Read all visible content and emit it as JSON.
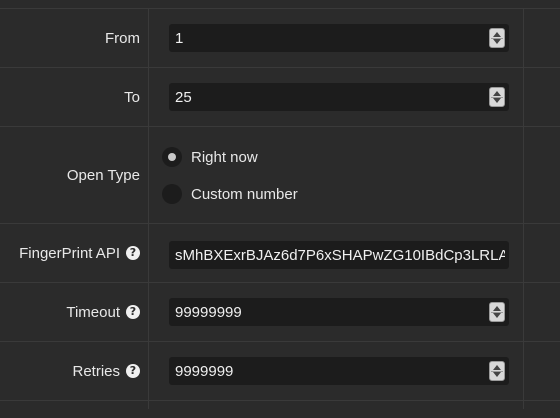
{
  "fields": {
    "from": {
      "label": "From",
      "value": "1"
    },
    "to": {
      "label": "To",
      "value": "25"
    },
    "open_type": {
      "label": "Open Type",
      "options": [
        {
          "label": "Right now",
          "checked": true
        },
        {
          "label": "Custom number",
          "checked": false
        }
      ]
    },
    "fingerprint_api": {
      "label": "FingerPrint API",
      "value": "sMhBXExrBJAz6d7P6xSHAPwZG10IBdCp3LRLA"
    },
    "timeout": {
      "label": "Timeout",
      "value": "99999999"
    },
    "retries": {
      "label": "Retries",
      "value": "9999999"
    }
  },
  "icons": {
    "help": "?"
  }
}
